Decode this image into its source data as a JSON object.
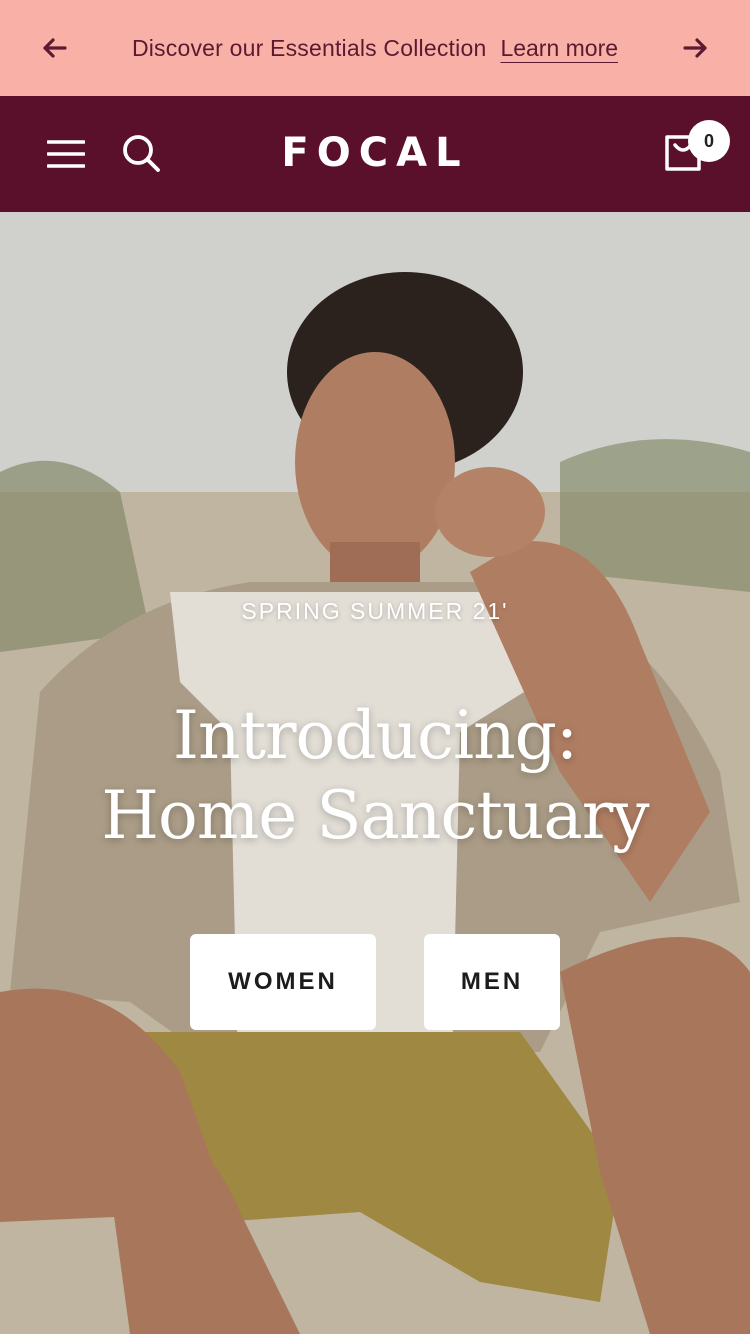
{
  "announcement": {
    "text": "Discover our Essentials Collection",
    "link": "Learn more"
  },
  "header": {
    "logo": "FOCAL",
    "cart_count": "0"
  },
  "hero": {
    "eyebrow": "SPRING SUMMER 21'",
    "headline_line1": "Introducing:",
    "headline_line2": "Home Sanctuary",
    "buttons": {
      "women": "WOMEN",
      "men": "MEN"
    }
  },
  "colors": {
    "announcement_bg": "#f9b0a6",
    "announcement_text": "#5b1a32",
    "header_bg": "#5a102b",
    "header_text": "#ffffff",
    "button_bg": "#ffffff",
    "button_text": "#1c1c1c"
  },
  "icons": [
    "arrow-left-icon",
    "arrow-right-icon",
    "hamburger-menu-icon",
    "search-icon",
    "cart-icon"
  ]
}
